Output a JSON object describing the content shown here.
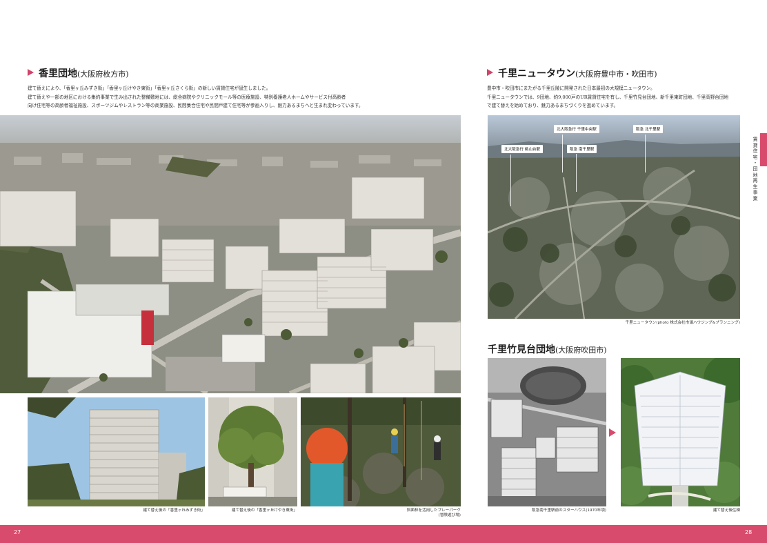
{
  "left_page": {
    "section": {
      "title": "香里団地",
      "subtitle": "(大阪府枚方市)",
      "lines": [
        "建て替えにより、「香里ヶ丘みずき街」「香里ヶ丘けやき東街」「香里ヶ丘さくら街」の新しい賃貸住宅が誕生しました。",
        "建て替えや一部の地区における集約事業で生み出された整備敷地には、総合病院やクリニックモール等の医療施設、特別養護老人ホームやサービス付高齢者",
        "向け住宅等の高齢者福祉施設、スポーツジムやレストラン等の商業施設、民間集合住宅や民間戸建て住宅等が参画入りし、魅力あるまちへと生まれ変わっています。"
      ]
    },
    "captions": {
      "photo1": "建て替え後の「香里ヶ丘みずき街」",
      "photo2": "建て替え後の「香里ヶ丘けやき東街」",
      "photo3_line1": "斜面林を活用したプレーパーク",
      "photo3_line2": "(冒険遊び場)"
    },
    "page_number": "27"
  },
  "right_page": {
    "section1": {
      "title": "千里ニュータウン",
      "subtitle": "(大阪府豊中市・吹田市)",
      "lines": [
        "豊中市・吹田市にまたがる千里丘陵に開発された日本最初の大規模ニュータウン。",
        "千里ニュータウンでは、9団地、約9,000戸のUR賃貸住宅を有し、千里竹見台団地、新千里東町団地、千里高野台団地",
        "で建て替えを始めており、魅力あるまちづくりを進めています。"
      ]
    },
    "map_labels": {
      "l1": "北大阪急行 千里中央駅",
      "l2": "阪急 北千里駅",
      "l3": "北大阪急行 桃山台駅",
      "l4": "阪急 南千里駅"
    },
    "aerial_credit": "千里ニュータウン(photo 株式会社市浦ハウジング&プランニング)",
    "section2": {
      "title": "千里竹見台団地",
      "subtitle": "(大阪府吹田市)"
    },
    "captions": {
      "before": "阪急南千里駅前のスターハウス(1970年頃)",
      "after": "建て替え後住棟"
    },
    "side_tab": [
      "賃",
      "貸",
      "住",
      "宅",
      "・",
      "団",
      "地",
      "再",
      "生",
      "事",
      "業"
    ],
    "page_number": "28"
  },
  "colors": {
    "accent": "#d94b6c"
  }
}
